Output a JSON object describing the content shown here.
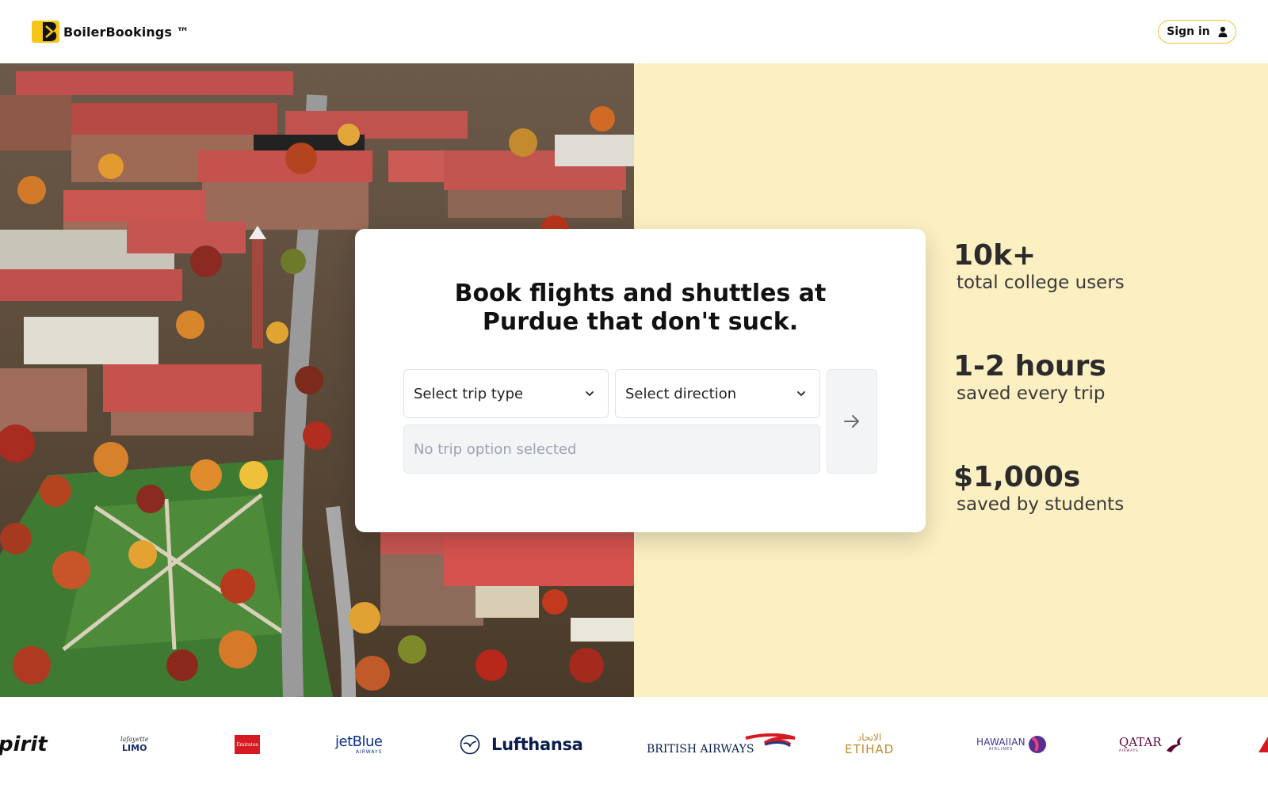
{
  "header": {
    "brand": "BoilerBookings ™",
    "sign_in_label": "Sign in"
  },
  "hero": {
    "headline_line1": "Book flights and shuttles at",
    "headline_line2": "Purdue that don't suck.",
    "trip_type_placeholder": "Select trip type",
    "direction_placeholder": "Select direction",
    "trip_status": "No trip option selected"
  },
  "stats": [
    {
      "value": "10k+",
      "label": "total college users"
    },
    {
      "value": "1-2 hours",
      "label": "saved every trip"
    },
    {
      "value": "$1,000s",
      "label": "saved by students"
    }
  ],
  "airlines": {
    "spirit": "pirit",
    "limo_small": "lafayette",
    "limo": "LIMO",
    "emirates": "Emirates",
    "jetblue": "jetBlue",
    "jetblue_sub": "AIRWAYS",
    "lufthansa": "Lufthansa",
    "british": "BRITISH AIRWAYS",
    "etihad_ar": "الاتحاد",
    "etihad": "ETIHAD",
    "hawaiian": "HAWAIIAN",
    "hawaiian_sub": "AIRLINES",
    "qatar": "QATAR",
    "qatar_sub": "AIRWAYS"
  },
  "colors": {
    "brand_yellow": "#f5c518",
    "panel_bg": "#fcefc2"
  }
}
